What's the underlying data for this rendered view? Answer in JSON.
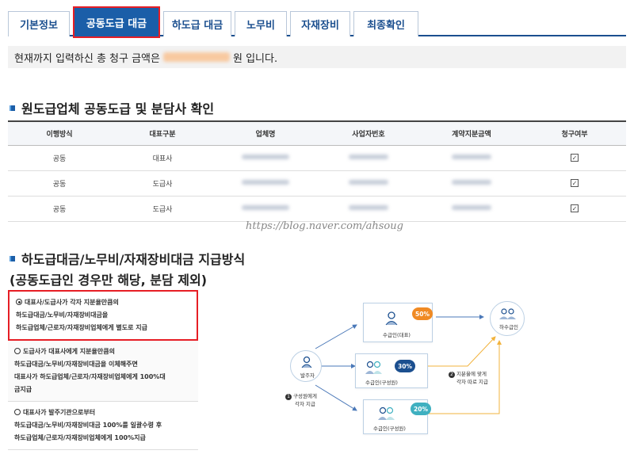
{
  "tabs": [
    {
      "label": "기본정보"
    },
    {
      "label": "공동도급 대금",
      "active": true
    },
    {
      "label": "하도급 대금"
    },
    {
      "label": "노무비"
    },
    {
      "label": "자재장비"
    },
    {
      "label": "최종확인"
    }
  ],
  "notice": {
    "prefix": "현재까지 입력하신 총 청구 금액은",
    "suffix": "원 입니다."
  },
  "section1": {
    "title": "원도급업체 공동도급 및 분담사 확인",
    "columns": [
      "이행방식",
      "대표구분",
      "업체명",
      "사업자번호",
      "계약지분금액",
      "청구여부"
    ],
    "rows": [
      {
        "method": "공동",
        "type": "대표사",
        "checked": "☑"
      },
      {
        "method": "공동",
        "type": "도급사",
        "checked": "☑"
      },
      {
        "method": "공동",
        "type": "도급사",
        "checked": "☑"
      }
    ]
  },
  "watermark": "https://blog.naver.com/ahsoug",
  "section2": {
    "title_line1": "하도급대금/노무비/자재장비대금 지급방식",
    "title_line2": "(공동도급인 경우만 해당, 분담 제외)"
  },
  "options": [
    {
      "lines": [
        "대표사/도급사가 각자 지분율만큼의",
        "하도급대금/노무비/자재장비대금을",
        "하도급업체/근로자/자재장비업체에게 별도로 지급"
      ],
      "selected": true
    },
    {
      "lines": [
        "도급사가 대표사에게 지분율만큼의",
        "하도급대금/노무비/자재장비대금을 이체해주면",
        "대표사가 하도급업체/근로자/자재장비업체에게 100%대",
        "금지급"
      ],
      "selected": false
    },
    {
      "lines": [
        "대표사가 발주기관으로부터",
        "하도급대금/노무비/자재장비대금 100%를 일괄수령 후",
        "하도급업체/근로자/자재장비업체에게 100%지급"
      ],
      "selected": false
    }
  ],
  "diagram": {
    "orderer": "발주자",
    "rep": "수급인(대표)",
    "member1": "수급인(구성원)",
    "member2": "수급인(구성원)",
    "sub": "하수급인",
    "pct_rep": "50%",
    "pct_m1": "30%",
    "pct_m2": "20%",
    "note1_num": "1",
    "note1_a": "구성원에게",
    "note1_b": "각자 지급",
    "note2_num": "2",
    "note2_a": "지분율에 맞게",
    "note2_b": "각자 따로 지급",
    "colors": {
      "orange": "#f08a24",
      "navy": "#1b4f8f",
      "teal": "#3fb0c0",
      "blue_arrow": "#4a78b8",
      "orange_arrow": "#f2b33d"
    }
  }
}
